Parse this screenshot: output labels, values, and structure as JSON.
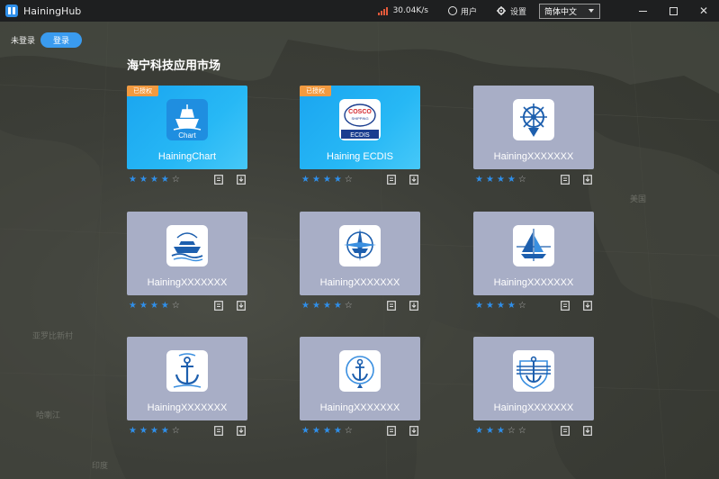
{
  "titlebar": {
    "app_name": "HainingHub",
    "net_speed": "30.04K/s",
    "user_label": "用户",
    "settings_label": "设置",
    "language": "简体中文",
    "minimize": "—",
    "maximize": "☐",
    "close": "✕"
  },
  "login": {
    "status": "未登录",
    "button": "登录"
  },
  "market_title": "海宁科技应用市场",
  "map_labels": [
    "美国",
    "亚罗比新村",
    "哈喇江",
    "印度"
  ],
  "apps": [
    {
      "name": "HainingChart",
      "badge": "已授权",
      "style": "blue",
      "icon": "ship-chart-icon",
      "icon_text": "Chart",
      "rating": 4
    },
    {
      "name": "Haining ECDIS",
      "badge": "已授权",
      "style": "blue",
      "icon": "cosco-ecdis-icon",
      "icon_top": "COSCO",
      "icon_mid": "SHIPPING",
      "icon_text": "ECDIS",
      "rating": 4
    },
    {
      "name": "HainingXXXXXXX",
      "badge": "",
      "style": "grey",
      "icon": "ship-wheel-icon",
      "rating": 4
    },
    {
      "name": "HainingXXXXXXX",
      "badge": "",
      "style": "grey",
      "icon": "cruise-ship-icon",
      "rating": 4
    },
    {
      "name": "HainingXXXXXXX",
      "badge": "",
      "style": "grey",
      "icon": "compass-ship-icon",
      "rating": 4
    },
    {
      "name": "HainingXXXXXXX",
      "badge": "",
      "style": "grey",
      "icon": "sailboat-compass-icon",
      "rating": 4
    },
    {
      "name": "HainingXXXXXXX",
      "badge": "",
      "style": "grey",
      "icon": "anchor-icon",
      "rating": 4
    },
    {
      "name": "HainingXXXXXXX",
      "badge": "",
      "style": "grey",
      "icon": "anchor-globe-icon",
      "rating": 4
    },
    {
      "name": "HainingXXXXXXX",
      "badge": "",
      "style": "grey",
      "icon": "anchor-shield-icon",
      "rating": 3
    }
  ],
  "colors": {
    "accent": "#2f8fea",
    "badge": "#f29a40",
    "card_grey": "#a8aec6",
    "card_blue": "#1aa5f0",
    "titlebar": "#1e1f20"
  }
}
